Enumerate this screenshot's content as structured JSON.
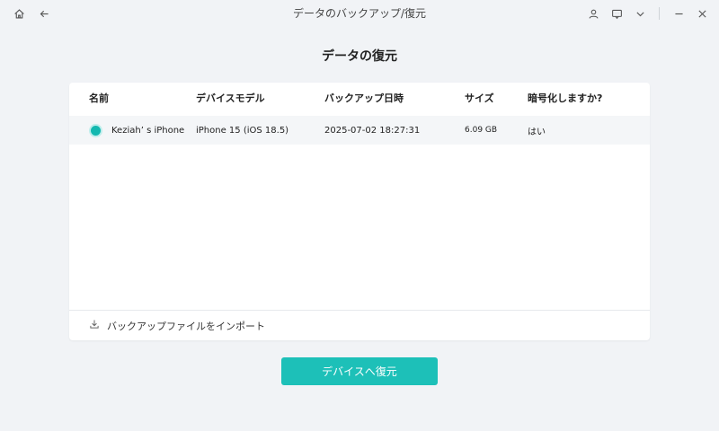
{
  "window": {
    "title": "データのバックアップ/復元",
    "icons": [
      "home-icon",
      "back-icon",
      "user-icon",
      "feedback-icon",
      "chevron-down-icon",
      "minimize-icon",
      "close-icon"
    ]
  },
  "page": {
    "title": "データの復元"
  },
  "table": {
    "columns": [
      "名前",
      "デバイスモデル",
      "バックアップ日時",
      "サイズ",
      "暗号化しますか?"
    ],
    "rows": [
      {
        "name": "Keziah’ s iPhone",
        "device": "iPhone 15 (iOS 18.5)",
        "date": "2025-07-02 18:27:31",
        "size": "6.09 GB",
        "encrypted": "はい",
        "selected": true
      }
    ]
  },
  "footer": {
    "import_label": "バックアップファイルをインポート",
    "icon": "import-icon"
  },
  "actions": {
    "restore_label": "デバイスへ復元"
  },
  "colors": {
    "accent": "#1dc0b8",
    "background": "#f1f3f6",
    "card": "#ffffff",
    "row_highlight": "#f4f6f8"
  }
}
